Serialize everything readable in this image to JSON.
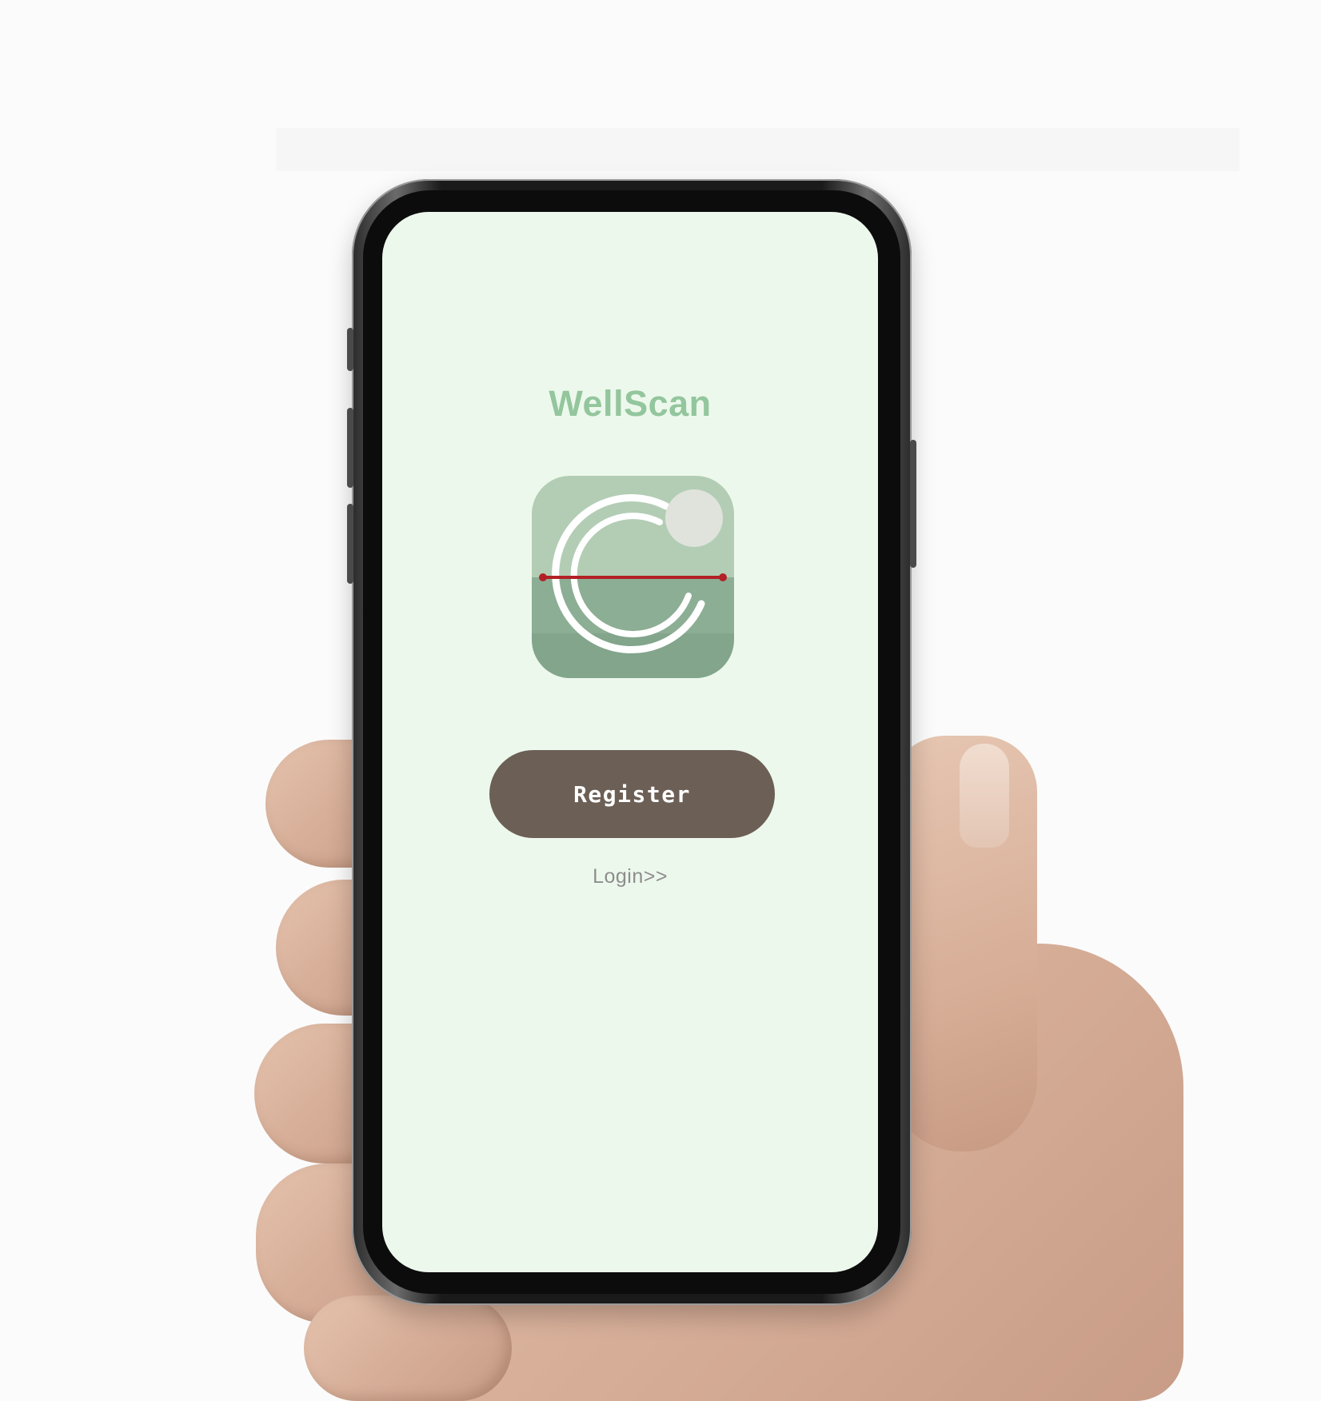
{
  "app": {
    "title": "WellScan"
  },
  "actions": {
    "register_label": "Register",
    "login_label": "Login>>"
  },
  "colors": {
    "background": "#edf8ec",
    "title": "#93c69d",
    "button": "#6c5f56",
    "scan_line": "#b22126",
    "icon_top": "#b2cdb4",
    "icon_bottom": "#82a58b"
  },
  "icons": {
    "logo": "scan-ring-logo-icon"
  }
}
